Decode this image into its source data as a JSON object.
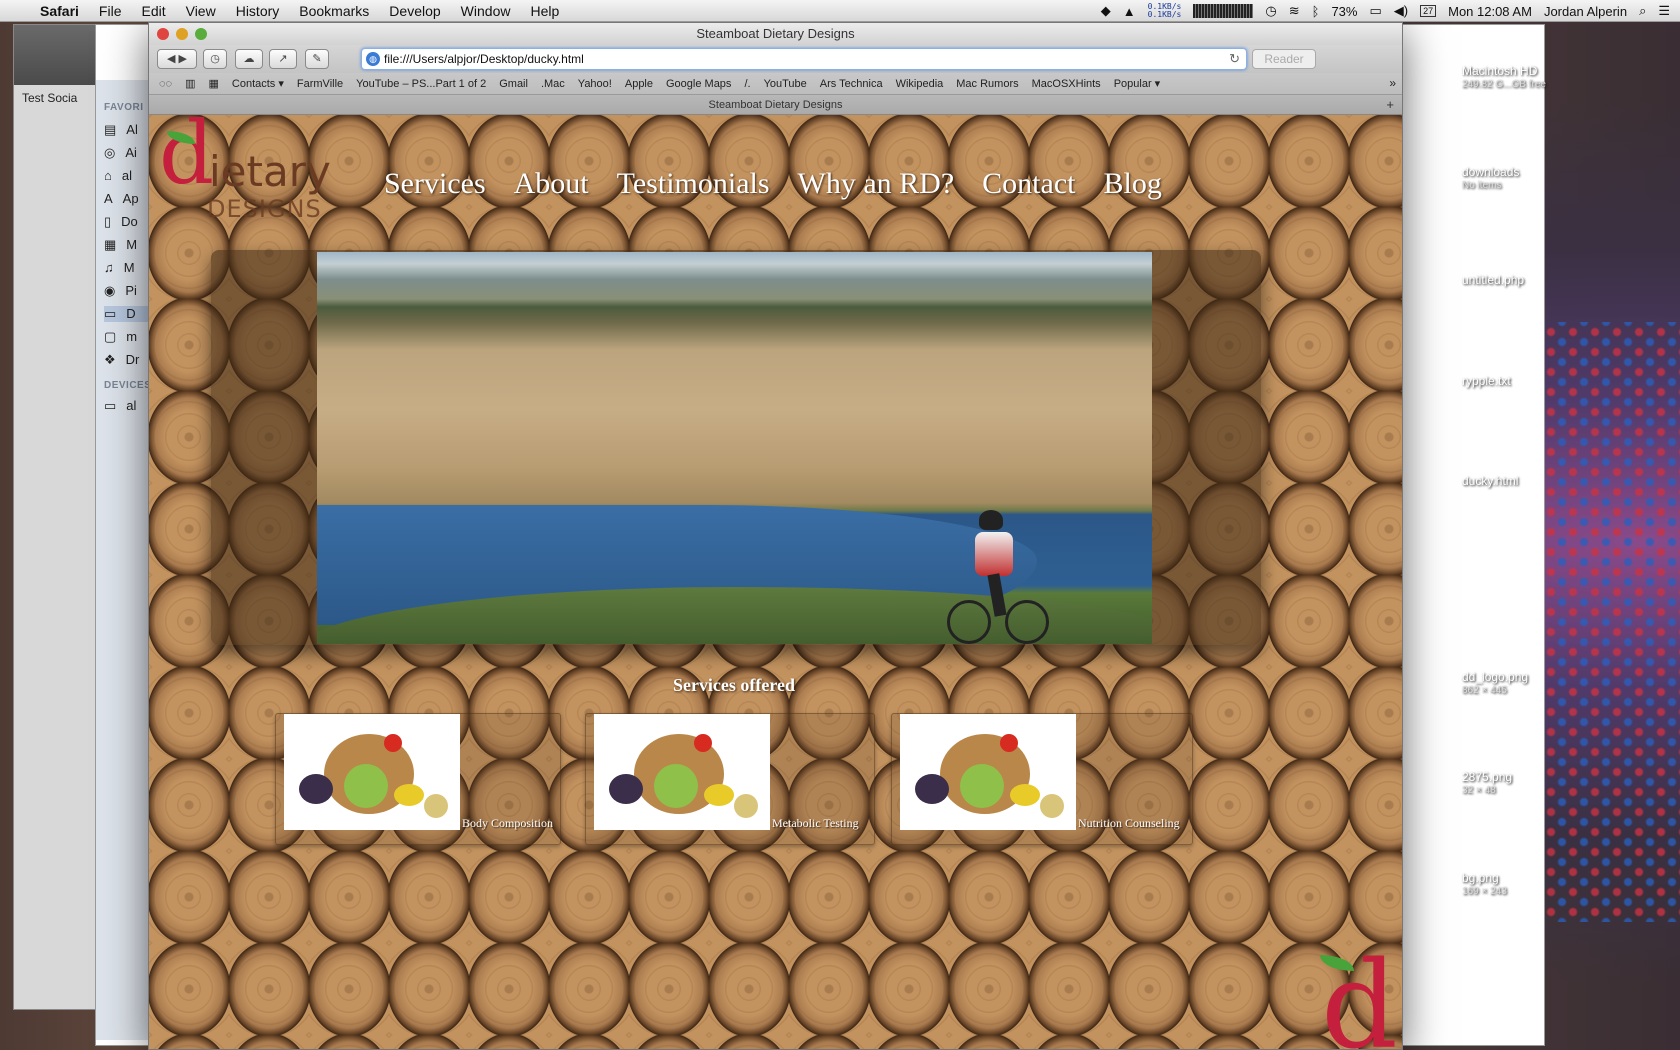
{
  "menubar": {
    "app": "Safari",
    "items": [
      "File",
      "Edit",
      "View",
      "History",
      "Bookmarks",
      "Develop",
      "Window",
      "Help"
    ],
    "net_up": "0.1KB/s",
    "net_down": "0.1KB/s",
    "battery": "73%",
    "date_badge": "27",
    "clock": "Mon 12:08 AM",
    "user": "Jordan Alperin"
  },
  "background_window": {
    "tab": "Test Socia"
  },
  "finder": {
    "favorites_header": "FAVORI",
    "items": [
      "Al",
      "Ai",
      "al",
      "Ap",
      "Do",
      "M",
      "M",
      "Pi",
      "D",
      "m",
      "Dr"
    ],
    "devices_header": "DEVICES",
    "device": "al"
  },
  "safari": {
    "window_title": "Steamboat Dietary Designs",
    "url": "file:///Users/alpjor/Desktop/ducky.html",
    "reader_label": "Reader",
    "bookmarks": [
      "Contacts ▾",
      "FarmVille",
      "YouTube – PS...Part 1 of 2",
      "Gmail",
      ".Mac",
      "Yahoo!",
      "Apple",
      "Google Maps",
      "/.",
      "YouTube",
      "Ars Technica",
      "Wikipedia",
      "Mac Rumors",
      "MacOSXHints",
      "Popular ▾"
    ],
    "tab_title": "Steamboat Dietary Designs"
  },
  "site": {
    "logo_d": "d",
    "logo_rest": "ietary",
    "logo_designs": "DESIGNS",
    "nav": [
      "Services",
      "About",
      "Testimonials",
      "Why an RD?",
      "Contact",
      "Blog"
    ],
    "services_title": "Services offered",
    "services": [
      {
        "label": "Body Composition"
      },
      {
        "label": "Metabolic Testing"
      },
      {
        "label": "Nutrition Counseling"
      }
    ],
    "corner_d": "d"
  },
  "desktop_icons": [
    {
      "name": "Macintosh HD",
      "sub": "249.82 G...GB free"
    },
    {
      "name": "downloads",
      "sub": "No items"
    },
    {
      "name": "untitled.php",
      "sub": ""
    },
    {
      "name": "rypple.txt",
      "sub": ""
    },
    {
      "name": "ducky.html",
      "sub": ""
    },
    {
      "name": "dd_logo.png",
      "sub": "862 × 445"
    },
    {
      "name": "2875.png",
      "sub": "32 × 48"
    },
    {
      "name": "bg.png",
      "sub": "169 × 243"
    }
  ],
  "colors": {
    "brand_red": "#c41f3c",
    "brand_brown": "#6a3b22",
    "leaf_green": "#47a33a"
  }
}
